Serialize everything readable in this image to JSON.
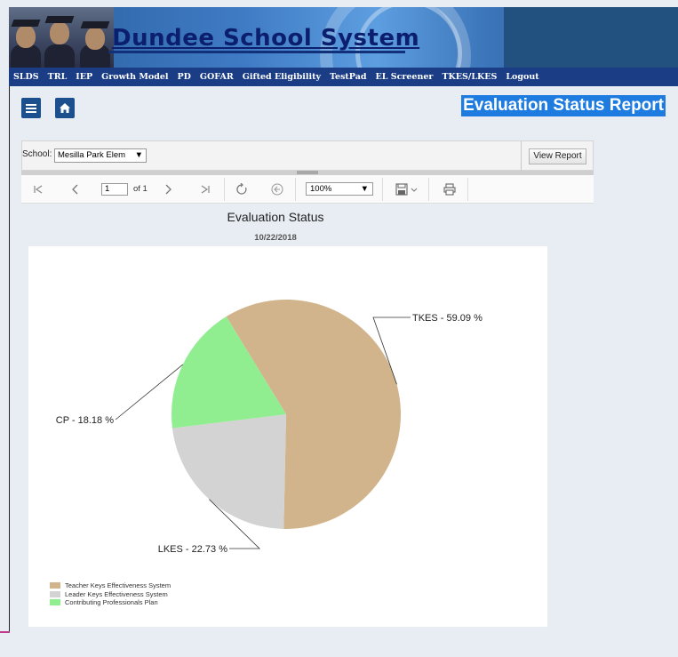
{
  "banner": {
    "title": "Dundee School System"
  },
  "nav": {
    "items": [
      "SLDS",
      "TRL",
      "IEP",
      "Growth Model",
      "PD",
      "GOFAR",
      "Gifted Eligibility",
      "TestPad",
      "EL Screener",
      "TKES/LKES",
      "Logout"
    ]
  },
  "header": {
    "menu_icon": "hamburger-icon",
    "home_icon": "home-icon",
    "report_title": "Evaluation Status Report"
  },
  "params": {
    "school_label": "School:",
    "school_value": "Mesilla Park Elem",
    "view_report_label": "View Report"
  },
  "toolbar": {
    "page_value": "1",
    "of_label": "of 1",
    "zoom_value": "100%"
  },
  "report": {
    "title": "Evaluation Status",
    "date": "10/22/2018"
  },
  "chart_data": {
    "type": "pie",
    "slices": [
      {
        "label": "TKES - 59.09 %",
        "legend": "Teacher Keys Effectiveness System",
        "value": 59.09,
        "color": "#d2b48c"
      },
      {
        "label": "LKES - 22.73 %",
        "legend": "Leader Keys Effectiveness System",
        "value": 22.73,
        "color": "#d3d3d3"
      },
      {
        "label": "CP - 18.18 %",
        "legend": "Contributing Professionals Plan",
        "value": 18.18,
        "color": "#90ee90"
      }
    ],
    "legend_position": "bottom-left"
  }
}
